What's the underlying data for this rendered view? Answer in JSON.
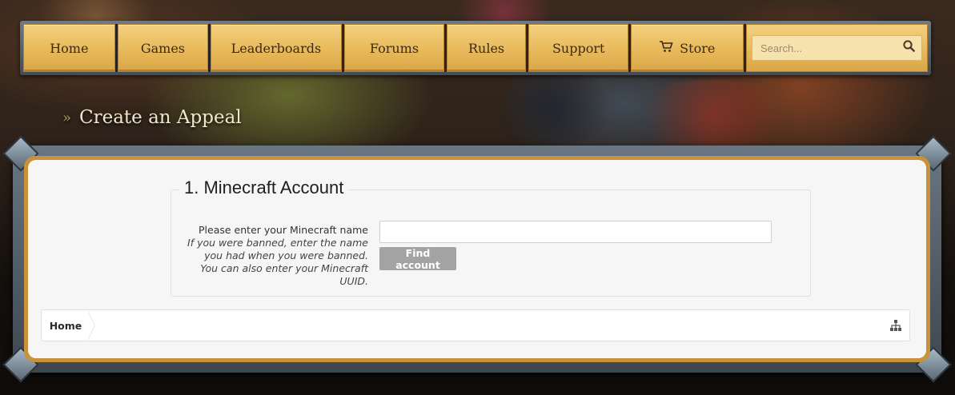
{
  "nav": {
    "items": [
      {
        "label": "Home"
      },
      {
        "label": "Games"
      },
      {
        "label": "Leaderboards"
      },
      {
        "label": "Forums"
      },
      {
        "label": "Rules"
      },
      {
        "label": "Support"
      },
      {
        "label": "Store",
        "icon": "cart-icon"
      }
    ],
    "search_placeholder": "Search...",
    "search_icon": "search-icon"
  },
  "page": {
    "title": "Create an Appeal",
    "title_prefix": "»"
  },
  "form": {
    "legend": "1. Minecraft Account",
    "label": "Please enter your Minecraft name",
    "hint": "If you were banned, enter the name you had when you were banned. You can also enter your Minecraft UUID.",
    "input_value": "",
    "button_label": "Find account"
  },
  "breadcrumb": {
    "home_label": "Home",
    "sitemap_icon": "sitemap-icon"
  },
  "colors": {
    "nav_gold": "#e8b95a",
    "button_disabled": "#a3a3a3",
    "panel_bg": "#f6f6f6",
    "frame_gold": "#c8923a"
  }
}
